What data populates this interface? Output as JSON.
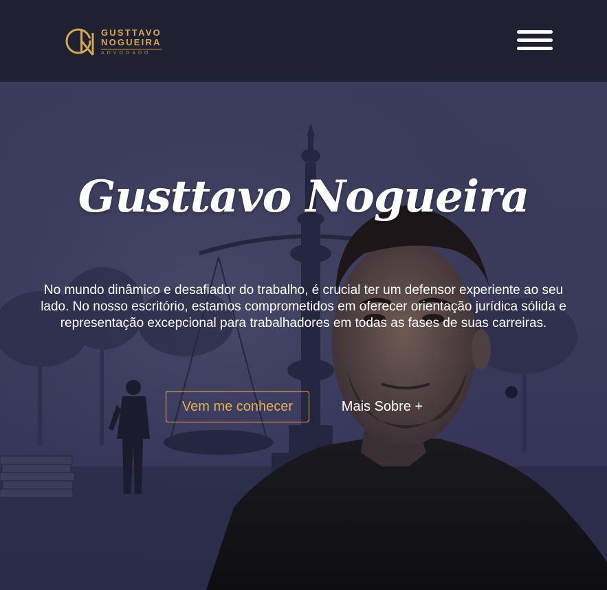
{
  "header": {
    "logo": {
      "line1": "GUSTTAVO",
      "line2": "NOGUEIRA",
      "line3": "ADVOGADO",
      "mark_icon": "gn-monogram-icon"
    },
    "menu_icon": "hamburger-menu-icon"
  },
  "hero": {
    "title": "Gusttavo Nogueira",
    "description": "No mundo dinâmico e desafiador do trabalho, é crucial ter um defensor experiente ao seu lado. No nosso escritório, estamos comprometidos em oferecer orientação jurídica sólida e representação excepcional para trabalhadores em todas as fases de suas carreiras.",
    "primary_button": "Vem me conhecer",
    "secondary_button": "Mais Sobre +"
  },
  "colors": {
    "header_bg": "#1f2032",
    "hero_bg": "#3a3b5a",
    "accent_gold": "#e3b14a",
    "text": "#ffffff"
  }
}
